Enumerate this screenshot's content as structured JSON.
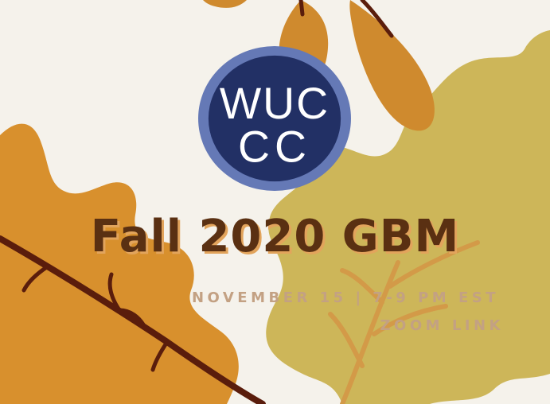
{
  "event": {
    "title": "Fall 2020 GBM",
    "date_time": "NOVEMBER 15 | 7-9 PM EST",
    "link_label": "ZOOM LINK"
  },
  "logo": {
    "letters_top": "WUC",
    "letters_bottom": "CC"
  },
  "decor": {
    "icon_names": [
      "orange-oak-leaf-icon",
      "olive-oak-leaf-icon",
      "hanging-leaf-icon",
      "leaf-stem-icon"
    ]
  },
  "colors": {
    "background": "#f5f2eb",
    "title": "#5a3012",
    "title_shadow": "#e2a45c",
    "subtitle": "#c3a183",
    "logo_ring": "#6579b6",
    "logo_fill": "#223065",
    "leaf_orange": "#d8902d",
    "leaf_olive": "#cdb659",
    "leaf_hanging": "#cf8a2e",
    "stem": "#5a1d0c"
  }
}
